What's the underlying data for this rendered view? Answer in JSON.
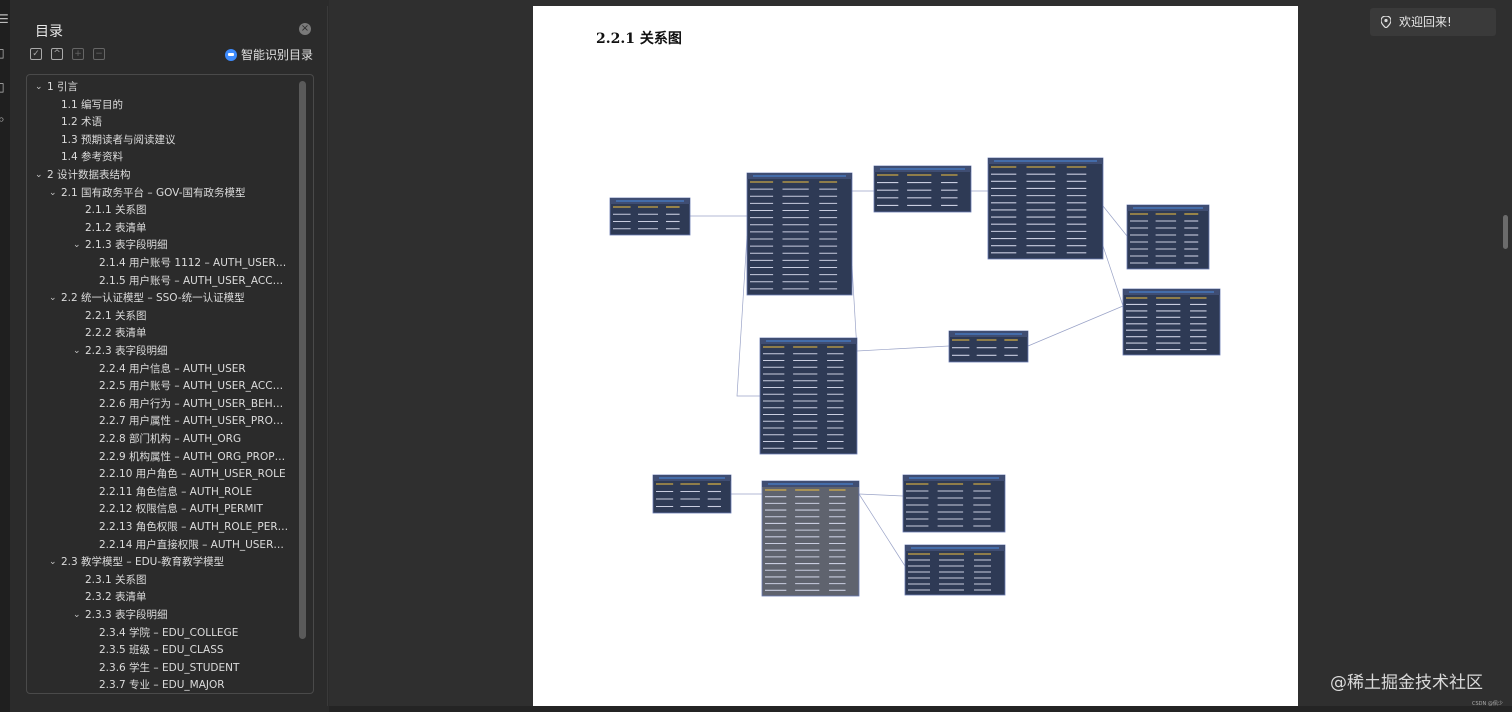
{
  "toc": {
    "title": "目录",
    "smart_label": "智能识别目录",
    "items": [
      {
        "label": "1 引言",
        "level": 0,
        "chev": "down"
      },
      {
        "label": "1.1 编写目的",
        "level": 1,
        "chev": ""
      },
      {
        "label": "1.2 术语",
        "level": 1,
        "chev": ""
      },
      {
        "label": "1.3 预期读者与阅读建议",
        "level": 1,
        "chev": ""
      },
      {
        "label": "1.4 参考资料",
        "level": 1,
        "chev": ""
      },
      {
        "label": "2 设计数据表结构",
        "level": 0,
        "chev": "down"
      },
      {
        "label": "2.1 国有政务平台 – GOV-国有政务模型",
        "level": 1,
        "chev": "down"
      },
      {
        "label": "2.1.1 关系图",
        "level": 2,
        "chev": ""
      },
      {
        "label": "2.1.2 表清单",
        "level": 2,
        "chev": ""
      },
      {
        "label": "2.1.3 表字段明细",
        "level": 2,
        "chev": "down"
      },
      {
        "label": "2.1.4 用户账号 1112 – AUTH_USER_ACCOUNT...",
        "level": 3,
        "chev": ""
      },
      {
        "label": "2.1.5 用户账号 – AUTH_USER_ACCOUNT2_...",
        "level": 3,
        "chev": ""
      },
      {
        "label": "2.2 统一认证模型 – SSO-统一认证模型",
        "level": 1,
        "chev": "down"
      },
      {
        "label": "2.2.1 关系图",
        "level": 2,
        "chev": ""
      },
      {
        "label": "2.2.2 表清单",
        "level": 2,
        "chev": ""
      },
      {
        "label": "2.2.3 表字段明细",
        "level": 2,
        "chev": "down"
      },
      {
        "label": "2.2.4 用户信息 – AUTH_USER",
        "level": 3,
        "chev": ""
      },
      {
        "label": "2.2.5 用户账号 – AUTH_USER_ACCOUNT",
        "level": 3,
        "chev": ""
      },
      {
        "label": "2.2.6 用户行为 – AUTH_USER_BEHAVIOR",
        "level": 3,
        "chev": ""
      },
      {
        "label": "2.2.7 用户属性 – AUTH_USER_PROPERTY...",
        "level": 3,
        "chev": ""
      },
      {
        "label": "2.2.8 部门机构 – AUTH_ORG",
        "level": 3,
        "chev": ""
      },
      {
        "label": "2.2.9 机构属性 – AUTH_ORG_PROPERTY",
        "level": 3,
        "chev": ""
      },
      {
        "label": "2.2.10 用户角色 – AUTH_USER_ROLE",
        "level": 3,
        "chev": ""
      },
      {
        "label": "2.2.11 角色信息 – AUTH_ROLE",
        "level": 3,
        "chev": ""
      },
      {
        "label": "2.2.12 权限信息 – AUTH_PERMIT",
        "level": 3,
        "chev": ""
      },
      {
        "label": "2.2.13 角色权限 – AUTH_ROLE_PERMIT",
        "level": 3,
        "chev": ""
      },
      {
        "label": "2.2.14 用户直接权限 – AUTH_USER_PERMI...",
        "level": 3,
        "chev": ""
      },
      {
        "label": "2.3 教学模型 – EDU-教育教学模型",
        "level": 1,
        "chev": "down"
      },
      {
        "label": "2.3.1 关系图",
        "level": 2,
        "chev": ""
      },
      {
        "label": "2.3.2 表清单",
        "level": 2,
        "chev": ""
      },
      {
        "label": "2.3.3 表字段明细",
        "level": 2,
        "chev": "down"
      },
      {
        "label": "2.3.4 学院 – EDU_COLLEGE",
        "level": 3,
        "chev": ""
      },
      {
        "label": "2.3.5 班级 – EDU_CLASS",
        "level": 3,
        "chev": ""
      },
      {
        "label": "2.3.6 学生 – EDU_STUDENT",
        "level": 3,
        "chev": ""
      },
      {
        "label": "2.3.7 专业 – EDU_MAJOR",
        "level": 3,
        "chev": ""
      }
    ]
  },
  "page": {
    "heading": "2.2.1  关系图"
  },
  "welcome": "欢迎回来!",
  "watermark": "@稀土掘金技术社区",
  "csdn": "CSDN @佩少",
  "colors": {
    "table_bg": "#2e3a55",
    "table_border": "#6a7bb3",
    "field_text": "#c9cde0",
    "key_text": "#f0c040",
    "link": "#9aa3c7"
  }
}
